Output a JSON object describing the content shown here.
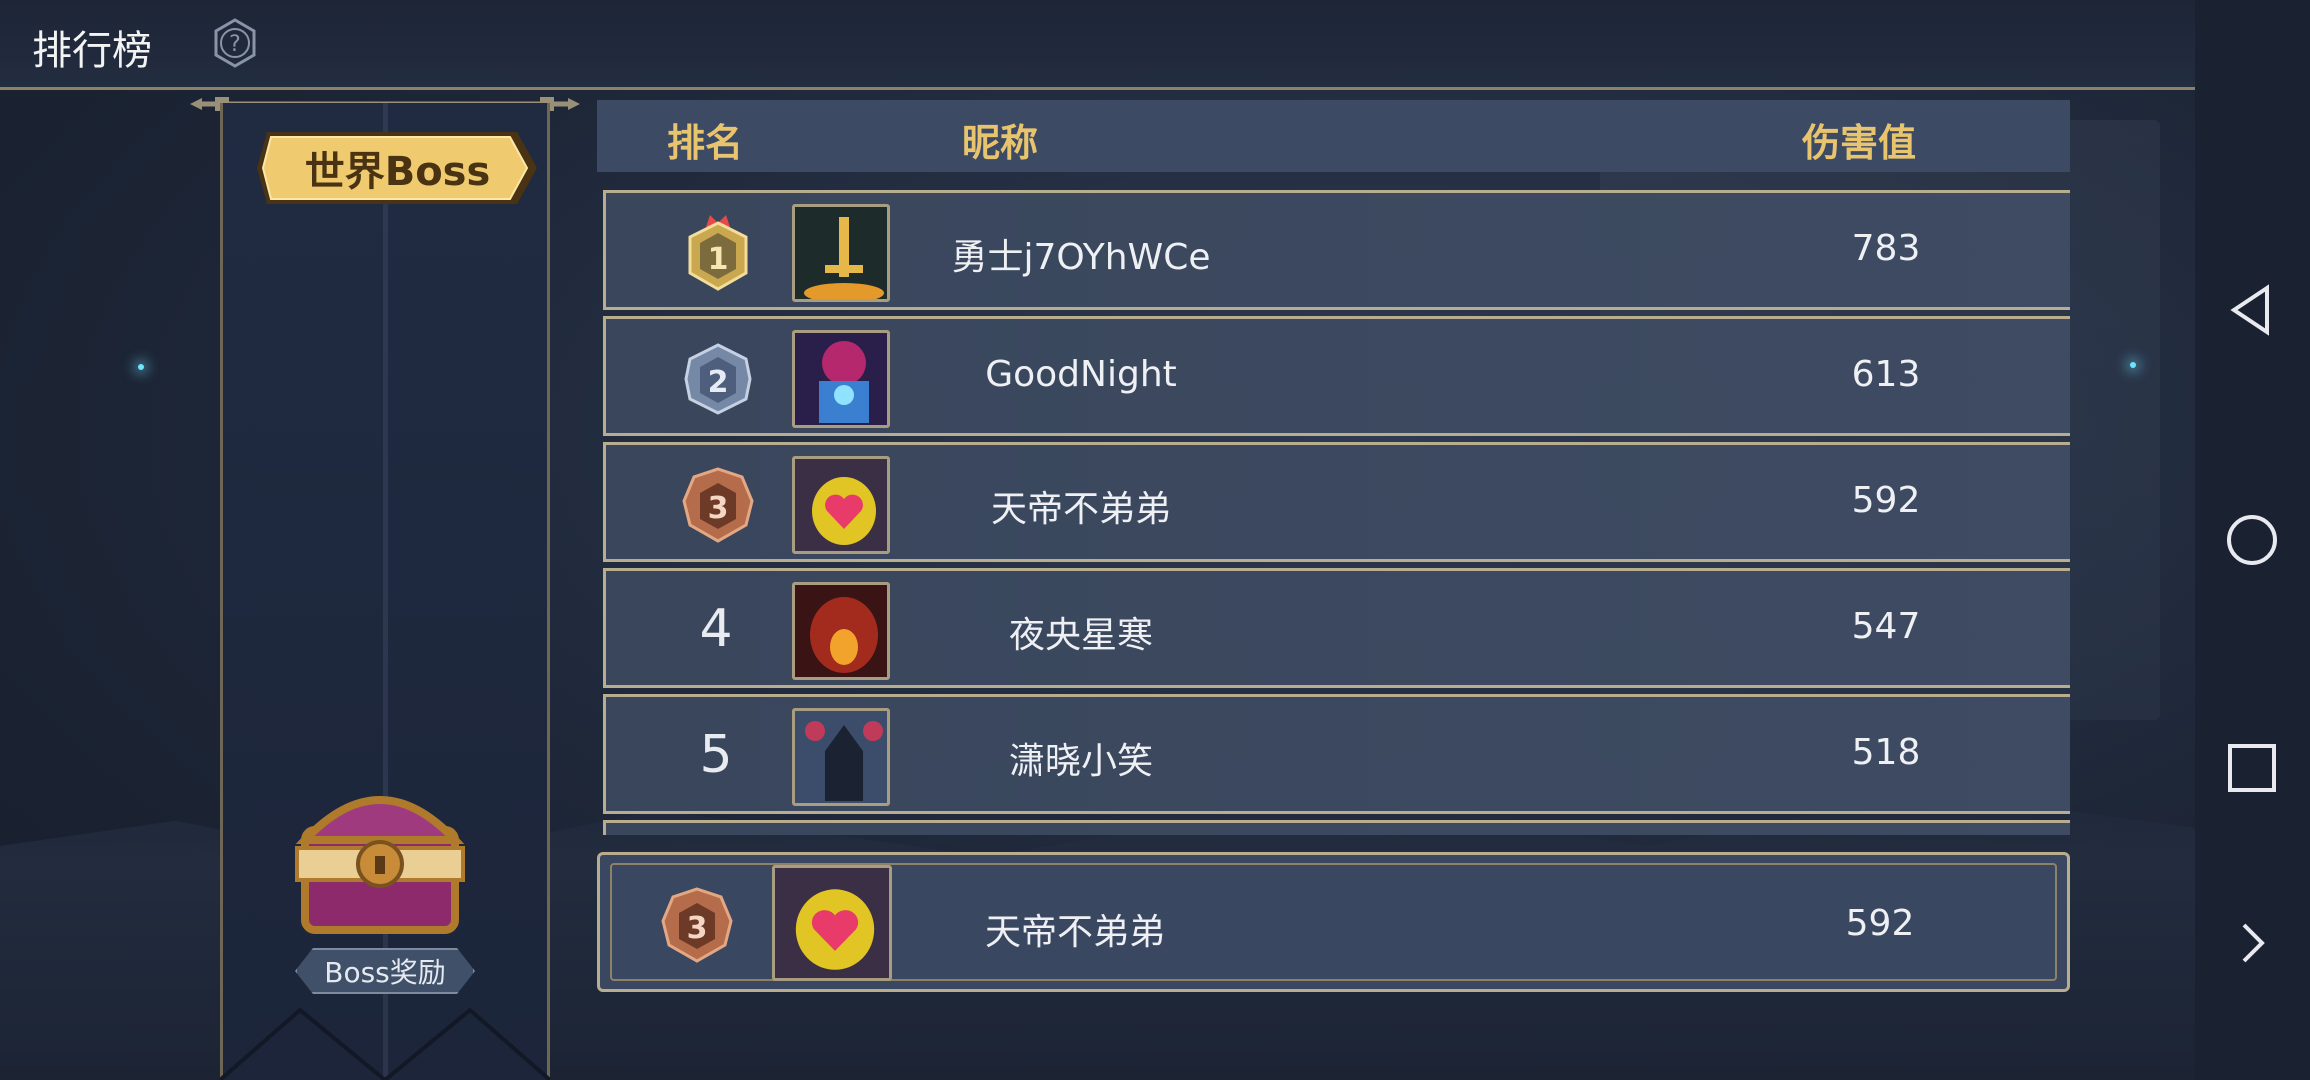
{
  "header": {
    "title": "排行榜"
  },
  "tabs": {
    "world_boss": "世界Boss"
  },
  "reward": {
    "label": "Boss奖励"
  },
  "table": {
    "columns": {
      "rank": "排名",
      "nickname": "昵称",
      "damage": "伤害值"
    },
    "rows": [
      {
        "rank": "1",
        "nickname": "勇士j7OYhWCe",
        "damage": "783",
        "medal": "gold",
        "avatar": "sword-avatar"
      },
      {
        "rank": "2",
        "nickname": "GoodNight",
        "damage": "613",
        "medal": "silver",
        "avatar": "demon-avatar"
      },
      {
        "rank": "3",
        "nickname": "天帝不弟弟",
        "damage": "592",
        "medal": "bronze",
        "avatar": "flame-heart-avatar"
      },
      {
        "rank": "4",
        "nickname": "夜央星寒",
        "damage": "547",
        "medal": null,
        "avatar": "dragon-avatar"
      },
      {
        "rank": "5",
        "nickname": "潇晓小笑",
        "damage": "518",
        "medal": null,
        "avatar": "dark-knight-avatar"
      }
    ]
  },
  "my_rank": {
    "rank": "3",
    "nickname": "天帝不弟弟",
    "damage": "592",
    "medal": "bronze",
    "avatar": "flame-heart-avatar"
  },
  "colors": {
    "gold": "#e9c46f",
    "frame": "#b9ad8f",
    "bg": "#1e2738"
  }
}
